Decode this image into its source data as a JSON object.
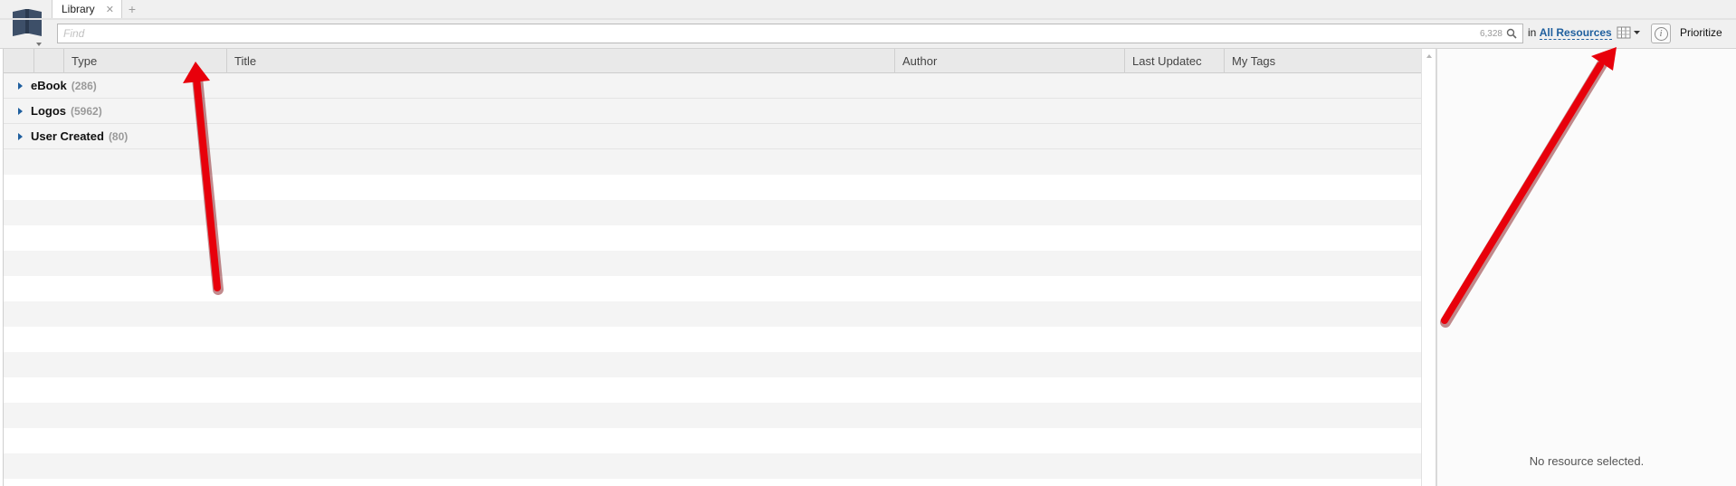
{
  "window": {
    "app_icon": "library-book-icon",
    "tabs": [
      {
        "label": "Library",
        "close_icon": "close-icon"
      }
    ],
    "add_tab_glyph": "+"
  },
  "toolbar": {
    "find_placeholder": "Find",
    "find_count": "6,328",
    "search_icon": "search-icon",
    "in_label": "in",
    "scope_label": "All Resources",
    "view_icon": "column-view-icon",
    "info_glyph": "i",
    "prioritize_label": "Prioritize"
  },
  "grid": {
    "columns": [
      {
        "key": "check",
        "label": ""
      },
      {
        "key": "type-icon",
        "label": ""
      },
      {
        "key": "type",
        "label": "Type"
      },
      {
        "key": "title",
        "label": "Title"
      },
      {
        "key": "author",
        "label": "Author"
      },
      {
        "key": "last_updated",
        "label": "Last Updatec"
      },
      {
        "key": "my_tags",
        "label": "My Tags"
      }
    ],
    "groups": [
      {
        "name": "eBook",
        "count": "(286)"
      },
      {
        "name": "Logos",
        "count": "(5962)"
      },
      {
        "name": "User Created",
        "count": "(80)"
      }
    ]
  },
  "panel": {
    "empty_message": "No resource selected."
  },
  "annotations": {
    "arrow_color": "#e8000b"
  }
}
